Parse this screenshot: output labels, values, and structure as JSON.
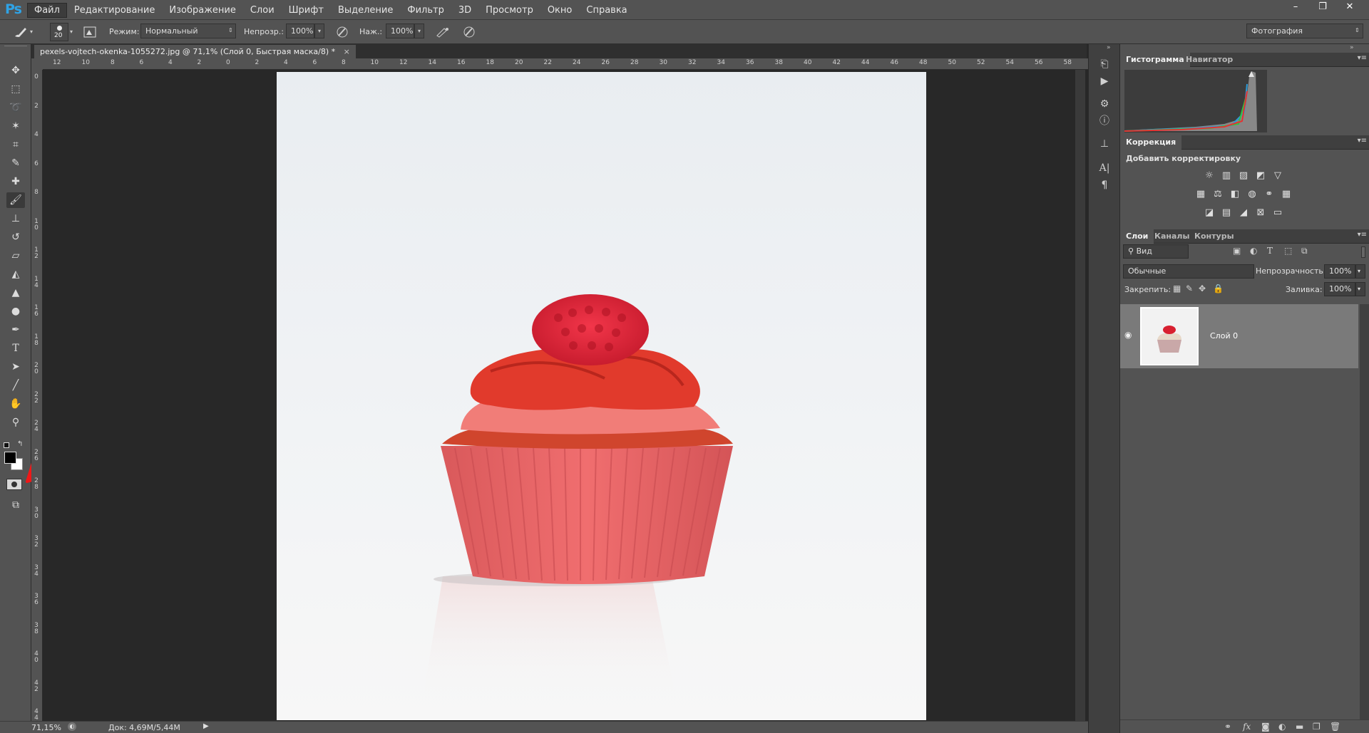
{
  "app": {
    "logo": "Ps",
    "menu": [
      "Файл",
      "Редактирование",
      "Изображение",
      "Слои",
      "Шрифт",
      "Выделение",
      "Фильтр",
      "3D",
      "Просмотр",
      "Окно",
      "Справка"
    ],
    "window_controls": [
      "–",
      "❐",
      "✕"
    ]
  },
  "options": {
    "brush_size": "20",
    "mode_label": "Режим:",
    "mode_value": "Нормальный",
    "opacity_label": "Непрозр.:",
    "opacity_value": "100%",
    "flow_label": "Наж.:",
    "flow_value": "100%",
    "workspace": "Фотография"
  },
  "document": {
    "tab_title": "pexels-vojtech-okenka-1055272.jpg @ 71,1% (Слой 0, Быстрая маска/8) *",
    "close": "×"
  },
  "ruler_top": [
    "12",
    "10",
    "8",
    "6",
    "4",
    "2",
    "0",
    "2",
    "4",
    "6",
    "8",
    "10",
    "12",
    "14",
    "16",
    "18",
    "20",
    "22",
    "24",
    "26",
    "28",
    "30",
    "32",
    "34",
    "36",
    "38",
    "40",
    "42",
    "44",
    "46",
    "48",
    "50",
    "52",
    "54",
    "56",
    "58"
  ],
  "ruler_left": [
    "0",
    "2",
    "4",
    "6",
    "8",
    "1\n0",
    "1\n2",
    "1\n4",
    "1\n6",
    "1\n8",
    "2\n0",
    "2\n2",
    "2\n4",
    "2\n6",
    "2\n8",
    "3\n0",
    "3\n2",
    "3\n4",
    "3\n6",
    "3\n8",
    "4\n0",
    "4\n2",
    "4\n4"
  ],
  "status": {
    "zoom": "71,15%",
    "doc_info": "Док: 4,69M/5,44M"
  },
  "panels": {
    "histogram_tabs": [
      "Гистограмма",
      "Навигатор"
    ],
    "correction_tab": "Коррекция",
    "add_adjustment": "Добавить корректировку",
    "layers_tabs": [
      "Слои",
      "Каналы",
      "Контуры"
    ],
    "filter_kind": "Вид",
    "blend_mode": "Обычные",
    "opacity_label": "Непрозрачность:",
    "opacity_value": "100%",
    "lock_label": "Закрепить:",
    "fill_label": "Заливка:",
    "fill_value": "100%",
    "layer_name": "Слой 0"
  }
}
